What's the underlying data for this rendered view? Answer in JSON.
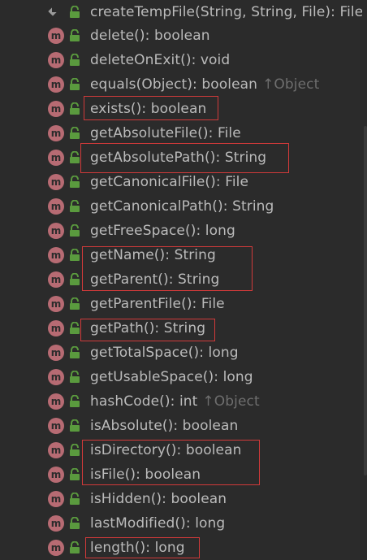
{
  "methods": [
    {
      "label": "createTempFile(String, String, File): File",
      "inherit": ""
    },
    {
      "label": "delete(): boolean",
      "inherit": ""
    },
    {
      "label": "deleteOnExit(): void",
      "inherit": ""
    },
    {
      "label": "equals(Object): boolean",
      "inherit": "↑Object"
    },
    {
      "label": "exists(): boolean",
      "inherit": ""
    },
    {
      "label": "getAbsoluteFile(): File",
      "inherit": ""
    },
    {
      "label": "getAbsolutePath(): String",
      "inherit": ""
    },
    {
      "label": "getCanonicalFile(): File",
      "inherit": ""
    },
    {
      "label": "getCanonicalPath(): String",
      "inherit": ""
    },
    {
      "label": "getFreeSpace(): long",
      "inherit": ""
    },
    {
      "label": "getName(): String",
      "inherit": ""
    },
    {
      "label": "getParent(): String",
      "inherit": ""
    },
    {
      "label": "getParentFile(): File",
      "inherit": ""
    },
    {
      "label": "getPath(): String",
      "inherit": ""
    },
    {
      "label": "getTotalSpace(): long",
      "inherit": ""
    },
    {
      "label": "getUsableSpace(): long",
      "inherit": ""
    },
    {
      "label": "hashCode(): int",
      "inherit": "↑Object"
    },
    {
      "label": "isAbsolute(): boolean",
      "inherit": ""
    },
    {
      "label": "isDirectory(): boolean",
      "inherit": ""
    },
    {
      "label": "isFile(): boolean",
      "inherit": ""
    },
    {
      "label": "isHidden(): boolean",
      "inherit": ""
    },
    {
      "label": "lastModified(): long",
      "inherit": ""
    },
    {
      "label": "length(): long",
      "inherit": ""
    }
  ],
  "method_icon_letter": "m",
  "colors": {
    "background": "#2b2b2b",
    "text": "#bbbbbb",
    "inherit_text": "#6e6e6e",
    "method_icon": "#b76b73",
    "lock_icon": "#5a9a3e",
    "highlight_box": "#d13a3a"
  },
  "icons": [
    "method-icon",
    "public-lock-icon",
    "static-method-icon"
  ]
}
